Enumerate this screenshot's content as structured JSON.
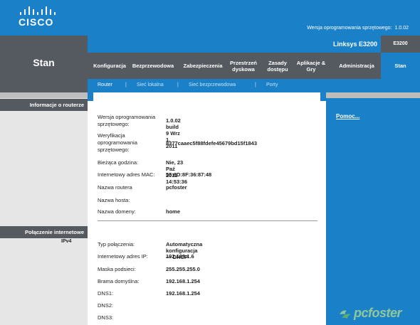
{
  "brand": {
    "logo_text": "CISCO"
  },
  "firmware_top": {
    "label": "Wersja oprogramowania sprzętowego:",
    "value": "1.0.02"
  },
  "page": {
    "title": "Stan",
    "model_name": "Linksys E3200",
    "model_code": "E3200"
  },
  "menu": [
    {
      "label": "Konfiguracja"
    },
    {
      "label": "Bezprzewodowa"
    },
    {
      "label": "Zabezpieczenia"
    },
    {
      "label": "Przestrzeń dyskowa"
    },
    {
      "label": "Zasady dostępu"
    },
    {
      "label": "Aplikacje & Gry"
    },
    {
      "label": "Administracja"
    },
    {
      "label": "Stan"
    }
  ],
  "subnav": [
    {
      "label": "Router"
    },
    {
      "label": "Sieć lokalna"
    },
    {
      "label": "Sieć bezprzewodowa"
    },
    {
      "label": "Porty"
    }
  ],
  "subnav_separator": "|",
  "sections": {
    "router_info": "Informacje o routerze",
    "internet": "Połączenie internetowe",
    "ipv4": "IPv4"
  },
  "router_info": [
    {
      "label": "Wersja oprogramowania sprzętowego:",
      "value": "1.0.02 build 9 Wrz 1, 2011"
    },
    {
      "label": "Weryfikacja oprogramowania sprzętowego:",
      "value": "8377caaec5f88fdefe45679bd15f1843"
    },
    {
      "label": "Bieżąca godzina:",
      "value": "Nie, 23 Paź 2011 14:53:36"
    },
    {
      "label": "Internetowy adres MAC:",
      "value": "58:6D:8F:36:87:48"
    },
    {
      "label": "Nazwa routera",
      "value": "pcfoster"
    },
    {
      "label": "Nazwa hosta:",
      "value": ""
    },
    {
      "label": "Nazwa domeny:",
      "value": "home"
    }
  ],
  "internet_info": [
    {
      "label": "Typ połączenia:",
      "value": "Automatyczna konfiguracja — DHCP"
    },
    {
      "label": "Internetowy adres IP:",
      "value": "192.168.1.6"
    },
    {
      "label": "Maska podsieci:",
      "value": "255.255.255.0"
    },
    {
      "label": "Brama domyślna:",
      "value": "192.168.1.254"
    },
    {
      "label": "DNS1:",
      "value": "192.168.1.254"
    },
    {
      "label": "DNS2:",
      "value": ""
    },
    {
      "label": "DNS3:",
      "value": ""
    }
  ],
  "help": {
    "label": "Pomoc..."
  },
  "watermark": {
    "text": "pcfoster"
  },
  "colors": {
    "blue": "#1a80c8",
    "dark_gray": "#555a60",
    "light_gray": "#e6e6e6"
  }
}
